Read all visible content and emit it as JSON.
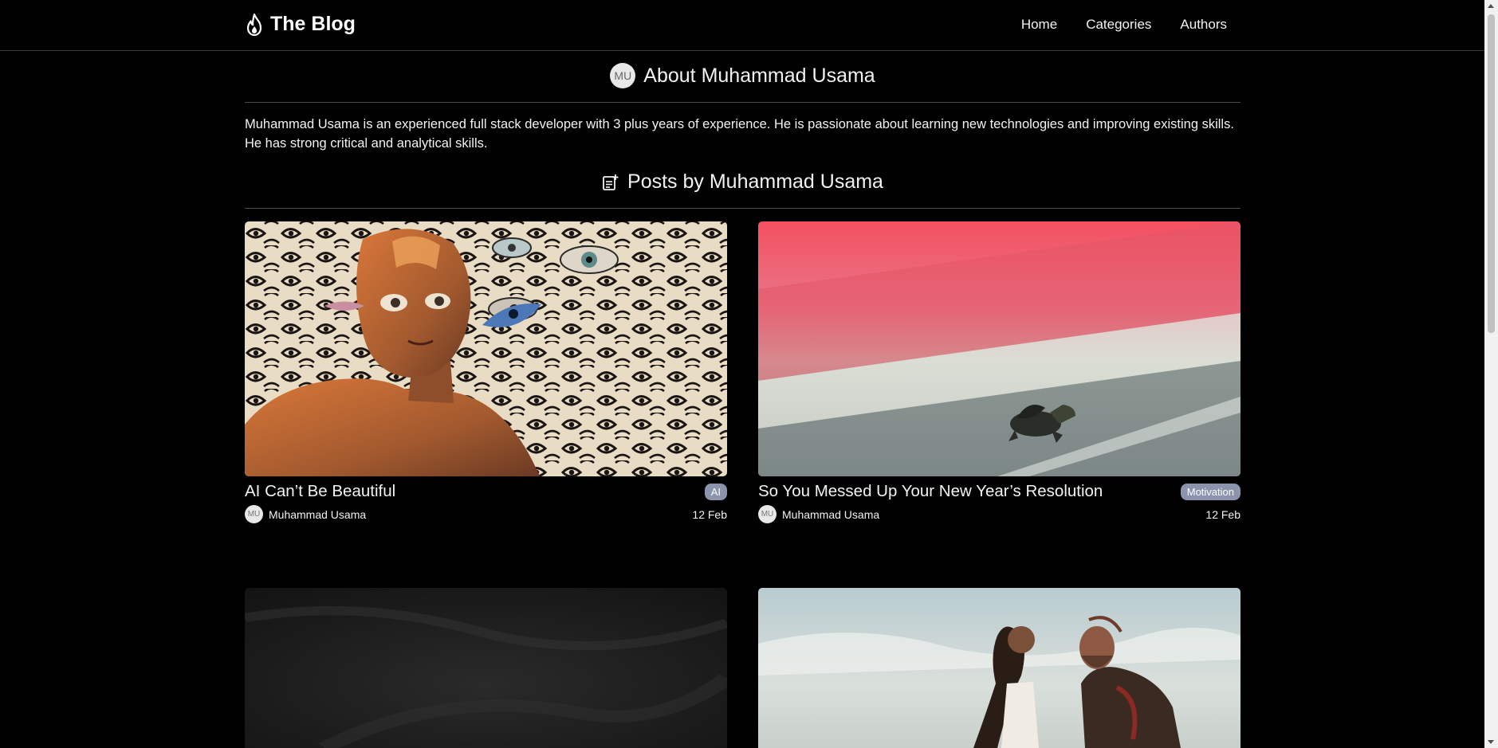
{
  "nav": {
    "brand": "The Blog",
    "links": [
      "Home",
      "Categories",
      "Authors"
    ]
  },
  "about": {
    "initials": "MU",
    "title": "About Muhammad Usama",
    "bio": "Muhammad Usama is an experienced full stack developer with 3 plus years of experience. He is passionate about learning new technologies and improving existing skills. He has strong critical and analytical skills."
  },
  "posts_section": {
    "title": "Posts by Muhammad Usama"
  },
  "posts": [
    {
      "title": "AI Can’t Be Beautiful",
      "category": "AI",
      "author": "Muhammad Usama",
      "author_initials": "MU",
      "date": "12 Feb"
    },
    {
      "title": "So You Messed Up Your New Year’s Resolution",
      "category": "Motivation",
      "author": "Muhammad Usama",
      "author_initials": "MU",
      "date": "12 Feb"
    }
  ],
  "colors": {
    "background": "#000000",
    "badge": "#8b93ad",
    "text": "#f2f2f2"
  }
}
